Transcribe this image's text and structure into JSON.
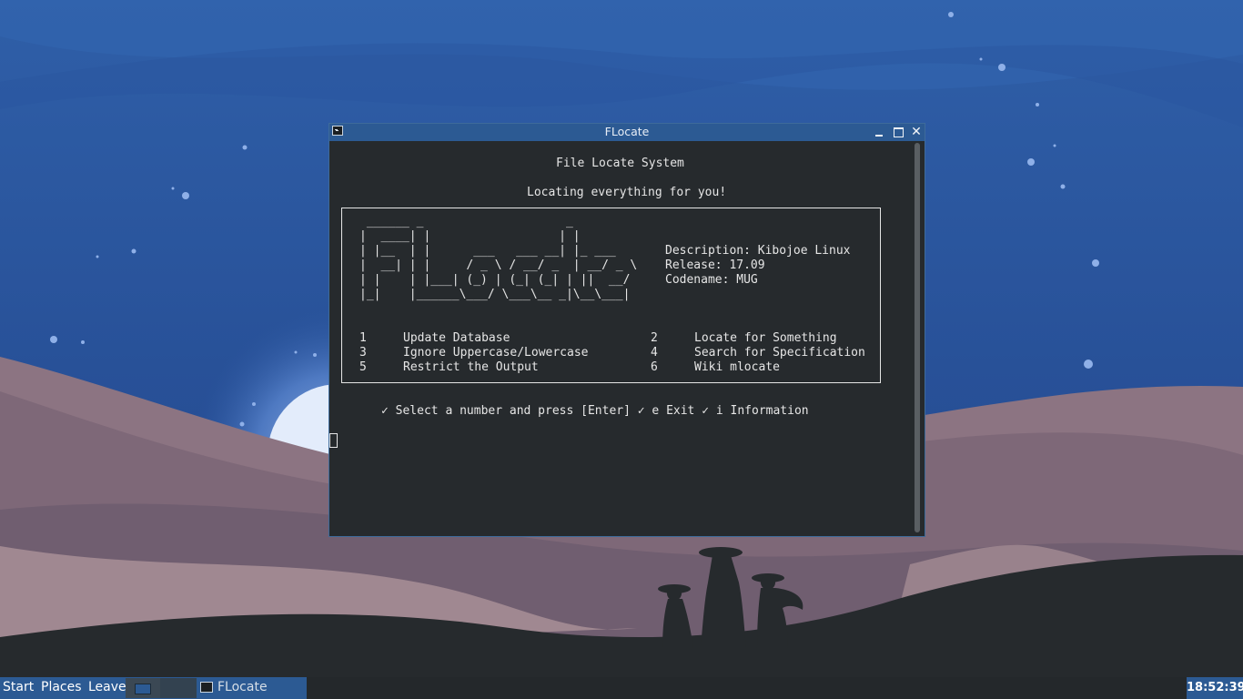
{
  "window": {
    "title": "FLocate"
  },
  "terminal": {
    "header": "File Locate System",
    "subheader": "Locating everything for you!",
    "logo": [
      " ______ _                    _",
      "|  ____| |                  | |",
      "| |__  | |      ___   ___ __| |_ ___",
      "|  __| | |     / _ \\ / __/ _  | __/ _ \\",
      "| |    | |___| (_) | (_| (_| | ||  __/",
      "|_|    |______\\___/ \\___\\__ _|\\__\\___|"
    ],
    "info": {
      "description": "Description: Kibojoe Linux",
      "release": "Release: 17.09",
      "codename": "Codename: MUG"
    },
    "menu": [
      {
        "num": "1",
        "label": "Update Database"
      },
      {
        "num": "2",
        "label": "Locate for Something"
      },
      {
        "num": "3",
        "label": "Ignore Uppercase/Lowercase"
      },
      {
        "num": "4",
        "label": "Search for Specification"
      },
      {
        "num": "5",
        "label": "Restrict the Output"
      },
      {
        "num": "6",
        "label": "Wiki mlocate"
      }
    ],
    "prompt": "✓ Select a number and press [Enter] ✓ e Exit ✓ i Information"
  },
  "taskbar": {
    "start": "Start",
    "places": "Places",
    "leave": "Leave",
    "task_label": "FLocate",
    "clock": "18:52:39"
  },
  "colors": {
    "accent": "#2c5a93",
    "terminal_bg": "#262a2d",
    "terminal_fg": "#e6e6e6",
    "taskbar_bg": "#24282b"
  }
}
